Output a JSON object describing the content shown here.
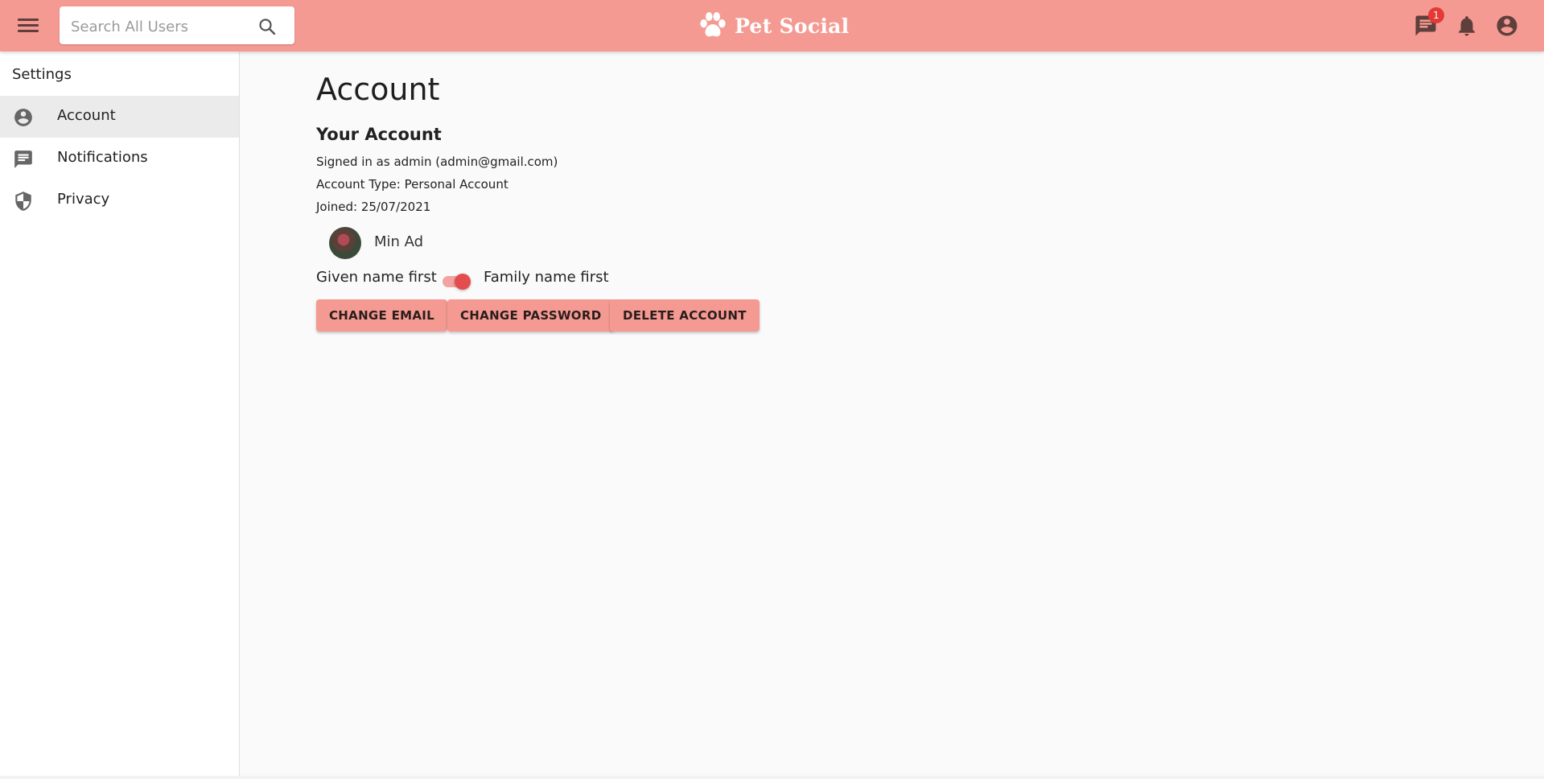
{
  "appbar": {
    "search_placeholder": "Search All Users",
    "brand": "Pet Social",
    "messages_badge": "1",
    "icons": {
      "menu": "menu-icon",
      "search": "search-icon",
      "messages": "chat-icon",
      "notifications": "bell-icon",
      "account": "account-circle-icon"
    },
    "colors": {
      "bar": "#f49a92",
      "badge": "#e53935"
    }
  },
  "sidebar": {
    "title": "Settings",
    "items": [
      {
        "label": "Account",
        "icon": "account-circle-icon",
        "active": true
      },
      {
        "label": "Notifications",
        "icon": "message-icon",
        "active": false
      },
      {
        "label": "Privacy",
        "icon": "shield-icon",
        "active": false
      }
    ]
  },
  "main": {
    "title": "Account",
    "section_title": "Your Account",
    "signed_in": "Signed in as admin (admin@gmail.com)",
    "account_type": "Account Type: Personal Account",
    "joined": "Joined: 25/07/2021",
    "display_name": "Min Ad",
    "name_order": {
      "left_label": "Given name first",
      "right_label": "Family name first",
      "family_name_first": true
    },
    "buttons": {
      "change_email": "CHANGE EMAIL",
      "change_password": "CHANGE PASSWORD",
      "delete_account": "DELETE ACCOUNT"
    }
  }
}
